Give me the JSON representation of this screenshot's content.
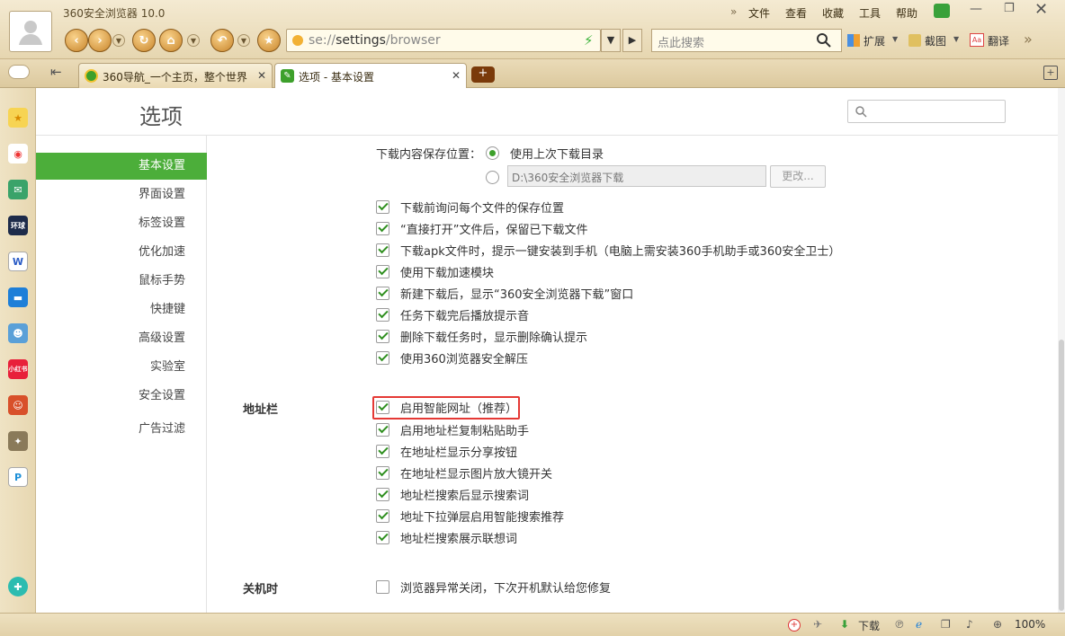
{
  "app": {
    "title": "360安全浏览器 10.0"
  },
  "menu": [
    "文件",
    "查看",
    "收藏",
    "工具",
    "帮助"
  ],
  "address": {
    "prefix": "se://",
    "bold": "settings",
    "suffix": "/browser"
  },
  "search": {
    "placeholder": "点此搜索"
  },
  "toolbar": {
    "extensions": "扩展",
    "screenshot": "截图",
    "translate": "翻译"
  },
  "tabs": [
    {
      "label": "360导航_一个主页，整个世界"
    },
    {
      "label": "选项 - 基本设置"
    }
  ],
  "sidebar_apps": [
    "收藏",
    "微博",
    "邮件",
    "环球网报",
    "文档",
    "消息",
    "游戏",
    "小红书",
    "游戏2",
    "游戏3",
    "P"
  ],
  "page": {
    "heading": "选项"
  },
  "nav": [
    "基本设置",
    "界面设置",
    "标签设置",
    "优化加速",
    "鼠标手势",
    "快捷键",
    "高级设置",
    "实验室",
    "安全设置",
    "广告过滤"
  ],
  "download": {
    "location_label": "下载内容保存位置：",
    "use_last": "使用上次下载目录",
    "path": "D:\\360安全浏览器下载",
    "change": "更改...",
    "options": [
      "下载前询问每个文件的保存位置",
      "“直接打开”文件后，保留已下载文件",
      "下载apk文件时，提示一键安装到手机（电脑上需安装360手机助手或360安全卫士）",
      "使用下载加速模块",
      "新建下载后，显示“360安全浏览器下载”窗口",
      "任务下载完后播放提示音",
      "删除下载任务时，显示删除确认提示",
      "使用360浏览器安全解压"
    ]
  },
  "addressbar": {
    "label": "地址栏",
    "options": [
      "启用智能网址（推荐）",
      "启用地址栏复制粘贴助手",
      "在地址栏显示分享按钮",
      "在地址栏显示图片放大镜开关",
      "地址栏搜索后显示搜索词",
      "地址下拉弹层启用智能搜索推荐",
      "地址栏搜索展示联想词"
    ]
  },
  "shutdown": {
    "label": "关机时",
    "option": "浏览器异常关闭，下次开机默认给您修复"
  },
  "status": {
    "download": "下载",
    "zoom": "100%"
  }
}
